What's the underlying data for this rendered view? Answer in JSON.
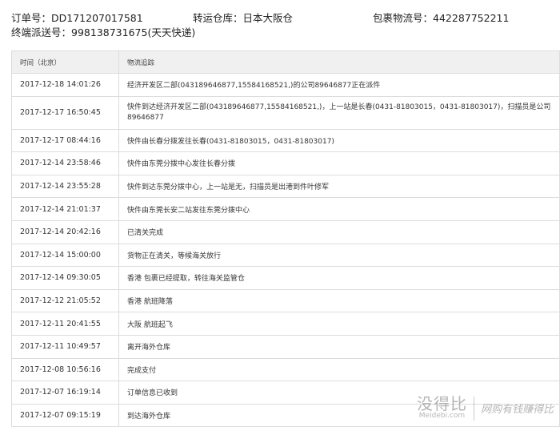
{
  "info": {
    "order_no_label": "订单号：",
    "order_no": "DD171207017581",
    "warehouse_label": "转运仓库：",
    "warehouse": "日本大阪仓",
    "parcel_no_label": "包裹物流号：",
    "parcel_no": "442287752211",
    "delivery_no_label": "终端派送号：",
    "delivery_no": "998138731675(天天快递)"
  },
  "table": {
    "headers": {
      "time": "时间（北京）",
      "track": "物流追踪"
    },
    "rows": [
      {
        "time": "2017-12-18 14:01:26",
        "event": "经济开发区二部(043189646877,15584168521,)的公司89646877正在派件"
      },
      {
        "time": "2017-12-17 16:50:45",
        "event": "快件到达经济开发区二部(043189646877,15584168521,)，上一站是长春(0431-81803015，0431-81803017)，扫描员是公司89646877"
      },
      {
        "time": "2017-12-17 08:44:16",
        "event": "快件由长春分拨发往长春(0431-81803015，0431-81803017)"
      },
      {
        "time": "2017-12-14 23:58:46",
        "event": "快件由东莞分拨中心发往长春分拨"
      },
      {
        "time": "2017-12-14 23:55:28",
        "event": "快件到达东莞分拨中心，上一站是无，扫描员是出港到件叶修军"
      },
      {
        "time": "2017-12-14 21:01:37",
        "event": "快件由东莞长安二站发往东莞分拨中心"
      },
      {
        "time": "2017-12-14 20:42:16",
        "event": "已清关完成"
      },
      {
        "time": "2017-12-14 15:00:00",
        "event": "货物正在清关，等候海关放行"
      },
      {
        "time": "2017-12-14 09:30:05",
        "event": "香港 包裹已经提取，转往海关监管仓"
      },
      {
        "time": "2017-12-12 21:05:52",
        "event": "香港 航班降落"
      },
      {
        "time": "2017-12-11 20:41:55",
        "event": "大阪 航班起飞"
      },
      {
        "time": "2017-12-11 10:49:57",
        "event": "离开海外仓库"
      },
      {
        "time": "2017-12-08 10:56:16",
        "event": "完成支付"
      },
      {
        "time": "2017-12-07 16:19:14",
        "event": "订单信息已收到"
      },
      {
        "time": "2017-12-07 09:15:19",
        "event": "到达海外仓库"
      }
    ]
  },
  "watermark": {
    "name": "没得比",
    "url": "Meidebi.com",
    "slogan": "网购有钱赚得比"
  }
}
